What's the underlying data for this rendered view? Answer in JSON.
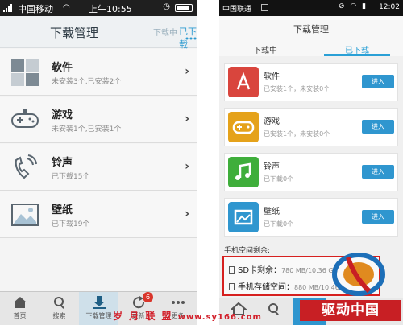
{
  "left": {
    "status": {
      "carrier": "中国移动",
      "time": "上午10:55"
    },
    "header": {
      "title": "下载管理",
      "tab_downloading": "下载中",
      "tab_downloaded": "已下载"
    },
    "rows": [
      {
        "name": "软件",
        "sub": "未安装3个,已安装2个",
        "icon": "app-grid-icon"
      },
      {
        "name": "游戏",
        "sub": "未安装1个,已安装1个",
        "icon": "gamepad-icon"
      },
      {
        "name": "铃声",
        "sub": "已下载15个",
        "icon": "phone-ring-icon"
      },
      {
        "name": "壁纸",
        "sub": "已下载19个",
        "icon": "picture-icon"
      }
    ],
    "tabbar": [
      {
        "label": "首页",
        "icon": "home-icon"
      },
      {
        "label": "搜索",
        "icon": "search-icon"
      },
      {
        "label": "下载管理",
        "icon": "download-icon",
        "active": true
      },
      {
        "label": "更新",
        "icon": "refresh-icon",
        "badge": "6"
      },
      {
        "label": "更多",
        "icon": "more-icon"
      }
    ]
  },
  "right": {
    "status": {
      "carrier": "中国联通",
      "time": "12:02"
    },
    "header": {
      "title": "下载管理",
      "tab_downloading": "下载中",
      "tab_downloaded": "已下载"
    },
    "cards": [
      {
        "name": "软件",
        "sub": "已安装1个，未安装0个",
        "button": "进入",
        "color": "#d9453d",
        "icon": "app-store-icon"
      },
      {
        "name": "游戏",
        "sub": "已安装1个，未安装0个",
        "button": "进入",
        "color": "#e5a21a",
        "icon": "gamepad-icon"
      },
      {
        "name": "铃声",
        "sub": "已下载0个",
        "button": "进入",
        "color": "#3fae3b",
        "icon": "music-note-icon"
      },
      {
        "name": "壁纸",
        "sub": "已下载0个",
        "button": "进入",
        "color": "#2f96cf",
        "icon": "picture-icon"
      }
    ],
    "space_title": "手机空间剩余:",
    "sd_label": "SD卡剩余：",
    "sd_value": "780 MB/10.36 GB",
    "phone_label": "手机存储空间：",
    "phone_value": "880 MB/10.46"
  },
  "watermark": {
    "text": "岁 月 联 盟",
    "domain": "www.sy166.com"
  },
  "logo_text": "驱动中国"
}
